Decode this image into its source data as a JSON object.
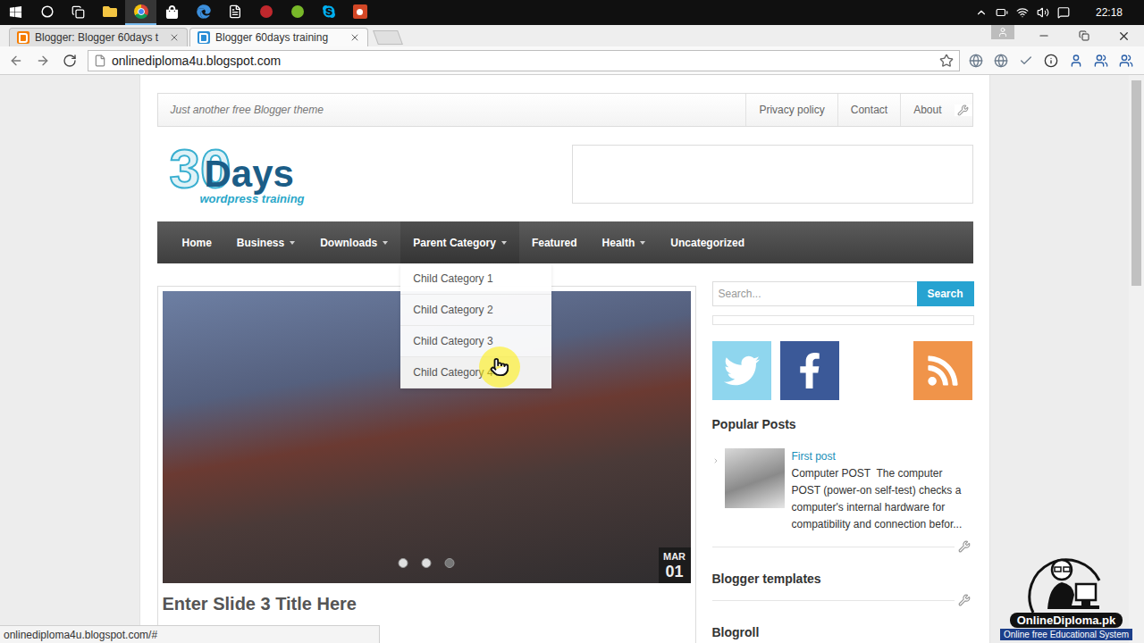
{
  "taskbar": {
    "apps": [
      {
        "kind": "start",
        "active": false
      },
      {
        "kind": "cortana",
        "active": false
      },
      {
        "kind": "task-view",
        "active": false
      },
      {
        "kind": "explorer",
        "active": false
      },
      {
        "kind": "chrome",
        "active": true
      },
      {
        "kind": "store",
        "active": false
      },
      {
        "kind": "edge",
        "active": false
      },
      {
        "kind": "notepad",
        "active": false
      },
      {
        "kind": "red-app",
        "active": false
      },
      {
        "kind": "utorrent",
        "active": false
      },
      {
        "kind": "skype",
        "active": false
      },
      {
        "kind": "powerpoint",
        "active": false
      }
    ],
    "time": "22:18"
  },
  "browser": {
    "tabs": [
      {
        "label": "Blogger: Blogger 60days t",
        "selected": false
      },
      {
        "label": "Blogger 60days training",
        "selected": true
      }
    ],
    "url": "onlinediploma4u.blogspot.com",
    "status_url": "onlinediploma4u.blogspot.com/#"
  },
  "page": {
    "tagline": "Just another free Blogger theme",
    "top_links": [
      "Privacy policy",
      "Contact",
      "About"
    ],
    "logo": {
      "number": "30",
      "word": "Days",
      "sub": "wordpress training"
    },
    "nav": [
      {
        "label": "Home",
        "dropdown": false,
        "selected": false,
        "open": false
      },
      {
        "label": "Business",
        "dropdown": true,
        "selected": false,
        "open": false
      },
      {
        "label": "Downloads",
        "dropdown": true,
        "selected": false,
        "open": false
      },
      {
        "label": "Parent Category",
        "dropdown": true,
        "selected": true,
        "open": true
      },
      {
        "label": "Featured",
        "dropdown": false,
        "selected": false,
        "open": false
      },
      {
        "label": "Health",
        "dropdown": true,
        "selected": false,
        "open": false
      },
      {
        "label": "Uncategorized",
        "dropdown": false,
        "selected": false,
        "open": false
      }
    ],
    "submenu": [
      {
        "label": "Child Category 1",
        "selected": false
      },
      {
        "label": "Child Category 2",
        "selected": false
      },
      {
        "label": "Child Category 3",
        "selected": false
      },
      {
        "label": "Child Category 4",
        "selected": true
      }
    ],
    "slider": {
      "title": "Enter Slide 3 Title Here",
      "month": "MAR",
      "day": "01",
      "dots": [
        {
          "selected": false
        },
        {
          "selected": false
        },
        {
          "selected": true
        }
      ]
    },
    "sidebar": {
      "search": {
        "placeholder": "Search...",
        "button": "Search"
      },
      "social": [
        {
          "kind": "twitter"
        },
        {
          "kind": "facebook"
        },
        {
          "kind": "rss"
        }
      ],
      "widgets": [
        {
          "title": "Popular Posts",
          "posts": [
            {
              "title": "First post",
              "excerpt": "Computer POST  The computer POST (power-on self-test) checks a computer's internal hardware for compatibility and connection befor..."
            }
          ]
        },
        {
          "title": "Blogger templates",
          "posts": []
        },
        {
          "title": "Blogroll",
          "posts": []
        }
      ]
    }
  },
  "watermark": {
    "name": "OnlineDiploma.pk",
    "tagline": "Online free Educational System"
  }
}
